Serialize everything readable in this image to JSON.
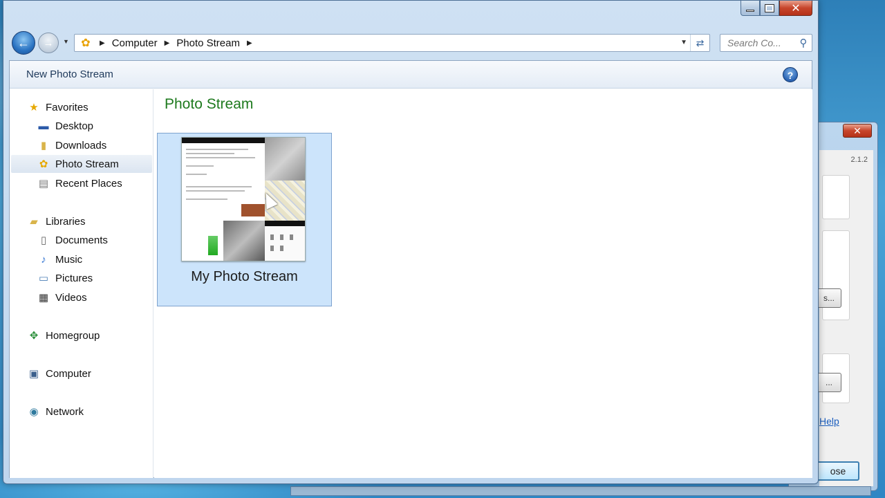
{
  "window": {
    "header_title": "New Photo Stream"
  },
  "address_bar": {
    "crumbs": [
      "Computer",
      "Photo Stream"
    ]
  },
  "search": {
    "placeholder": "Search Co..."
  },
  "sidebar": {
    "favorites_label": "Favorites",
    "favorites": [
      "Desktop",
      "Downloads",
      "Photo Stream",
      "Recent Places"
    ],
    "selected": "Photo Stream",
    "libraries_label": "Libraries",
    "libraries": [
      "Documents",
      "Music",
      "Pictures",
      "Videos"
    ],
    "homegroup_label": "Homegroup",
    "computer_label": "Computer",
    "network_label": "Network"
  },
  "main": {
    "section_title": "Photo Stream",
    "items": [
      {
        "label": "My Photo Stream"
      }
    ]
  },
  "background_window": {
    "version": "2.1.2",
    "help_link": "Help",
    "close_button_partial": "ose",
    "button_partial": "s..."
  },
  "icons": {
    "back": "back-arrow-icon",
    "forward": "forward-arrow-icon",
    "refresh": "refresh-icon",
    "search": "search-icon",
    "help": "help-icon"
  },
  "colors": {
    "section_title": "#1e7a1e",
    "selection": "#cce4fb",
    "accent": "#2a73c2"
  }
}
